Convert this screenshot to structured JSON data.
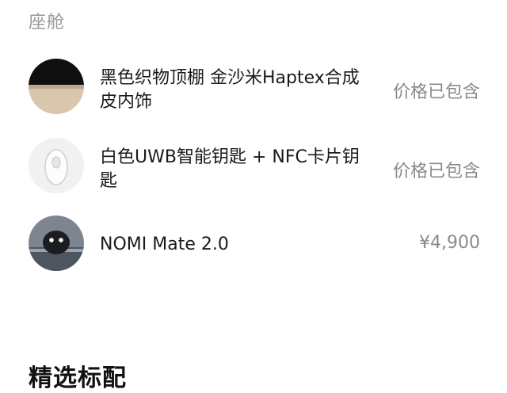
{
  "cabin": {
    "section_label": "座舱",
    "items": [
      {
        "name": "黑色织物顶棚 金沙米Haptex合成皮内饰",
        "price": "价格已包含",
        "thumb_icon": "headliner-swatch-icon"
      },
      {
        "name": "白色UWB智能钥匙 + NFC卡片钥匙",
        "price": "价格已包含",
        "thumb_icon": "smart-key-icon"
      },
      {
        "name": "NOMI Mate 2.0",
        "price": "¥4,900",
        "thumb_icon": "nomi-robot-icon"
      }
    ]
  },
  "featured": {
    "section_title": "精选标配"
  }
}
